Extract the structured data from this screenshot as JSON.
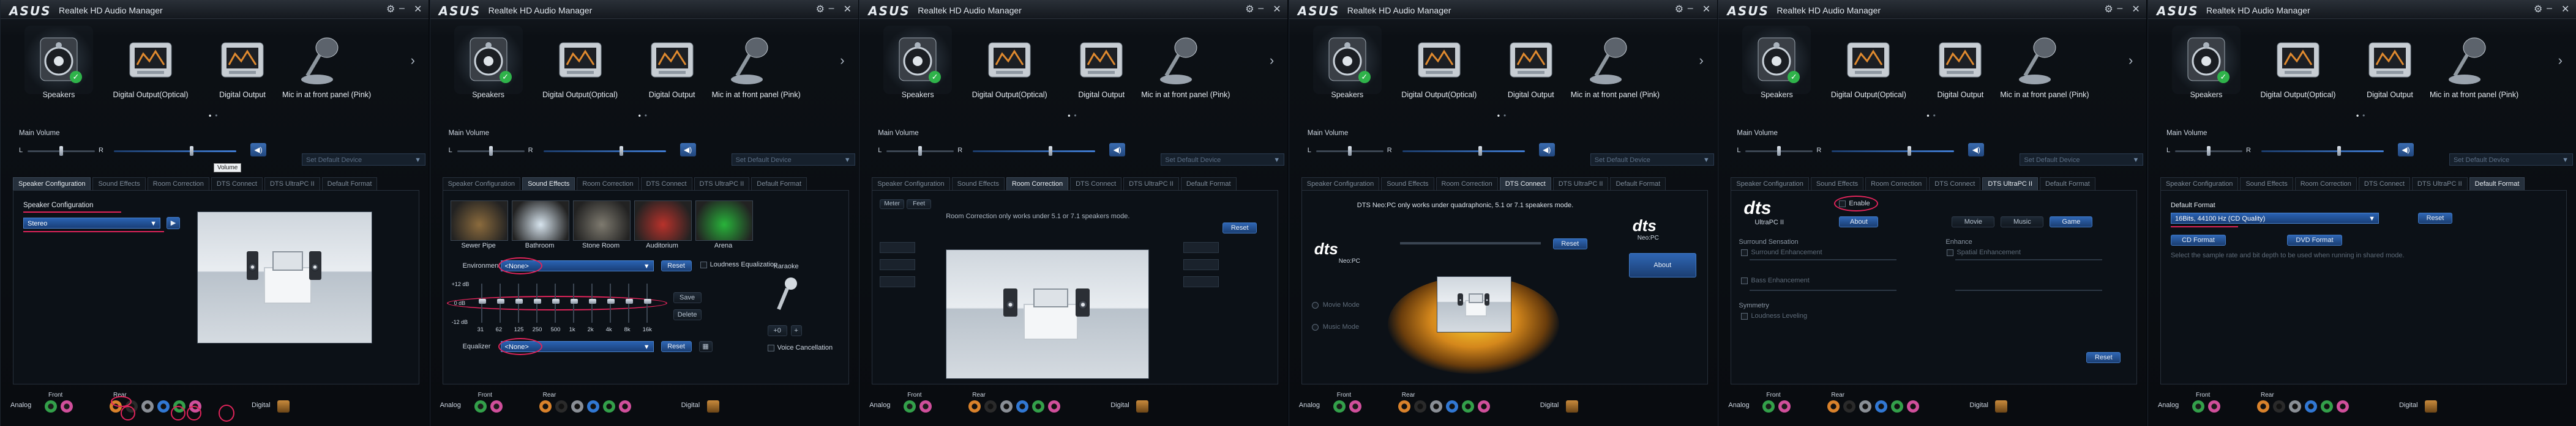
{
  "app": {
    "logo": "ASUS",
    "title": "Realtek HD Audio Manager",
    "gear": "⚙",
    "minimize": "–",
    "close": "✕"
  },
  "devices": [
    {
      "label": "Speakers",
      "icon": "speaker-icon",
      "selected": true
    },
    {
      "label": "Digital Output(Optical)",
      "icon": "optical-output-icon",
      "selected": false
    },
    {
      "label": "Digital Output",
      "icon": "digital-output-icon",
      "selected": false
    },
    {
      "label": "Mic in at front panel (Pink)",
      "icon": "microphone-icon",
      "selected": false
    }
  ],
  "main_volume": {
    "label": "Main Volume",
    "left": "L",
    "right": "R",
    "tooltip": "Volume",
    "volume_level_fraction": 0.62,
    "set_default": "Set Default Device"
  },
  "tabs": [
    "Speaker Configuration",
    "Sound Effects",
    "Room Correction",
    "DTS Connect",
    "DTS UltraPC II",
    "Default Format"
  ],
  "bottom": {
    "front": "Front",
    "rear": "Rear",
    "analog": "Analog",
    "digital": "Digital"
  },
  "panel1": {
    "section_label": "Speaker Configuration",
    "config_value": "Stereo",
    "play_symbol": "▶"
  },
  "panel2": {
    "environments": [
      "Sewer Pipe",
      "Bathroom",
      "Stone Room",
      "Auditorium",
      "Arena"
    ],
    "environment_label": "Environment",
    "environment_value": "<None>",
    "reset": "Reset",
    "loudness": "Loudness Equalization",
    "karaoke": "Karaoke",
    "db_top": "+12 dB",
    "db_mid": "0 dB",
    "db_bottom": "-12 dB",
    "eq_freqs": [
      "31",
      "62",
      "125",
      "250",
      "500",
      "1k",
      "2k",
      "4k",
      "8k",
      "16k"
    ],
    "equalizer_label": "Equalizer",
    "equalizer_value": "<None>",
    "save": "Save",
    "delete": "Delete",
    "karaoke_value": "+0",
    "voice_cancel": "Voice Cancellation"
  },
  "panel3": {
    "header_left": "Meter",
    "header_right": "Feet",
    "notice": "Room Correction only works under 5.1 or 7.1 speakers mode.",
    "reset": "Reset"
  },
  "panel4": {
    "notice": "DTS Neo:PC only works under quadraphonic, 5.1 or 7.1 speakers mode.",
    "logo": "dts",
    "logo_sub": "Neo:PC",
    "movie_mode": "Movie Mode",
    "music_mode": "Music Mode",
    "reset": "Reset",
    "about": "About"
  },
  "panel5": {
    "logo": "dts",
    "logo_sub": "UltraPC II",
    "enable": "Enable",
    "about": "About",
    "modes": [
      "Movie",
      "Music",
      "Game"
    ],
    "surround_sensation": "Surround Sensation",
    "surround_enhancement": "Surround Enhancement",
    "bass_enhancement": "Bass Enhancement",
    "symmetry": "Symmetry",
    "loudness_leveling": "Loudness Leveling",
    "enhance": "Enhance",
    "spatial_enhancement": "Spatial Enhancement",
    "reset": "Reset"
  },
  "panel6": {
    "label": "Default Format",
    "format_value": "16Bits, 44100 Hz (CD Quality)",
    "reset": "Reset",
    "cd_format": "CD Format",
    "dvd_format": "DVD Format",
    "hint": "Select the sample rate and bit depth to be used when running in shared mode."
  },
  "colors": {
    "annotation": "#e0245a",
    "accent_blue": "#2f66b4",
    "jack_green": "#33a04a",
    "jack_pink": "#d04f9b",
    "jack_orange": "#d9822b",
    "jack_black": "#2a2a2a",
    "jack_gray": "#8a8f96"
  }
}
